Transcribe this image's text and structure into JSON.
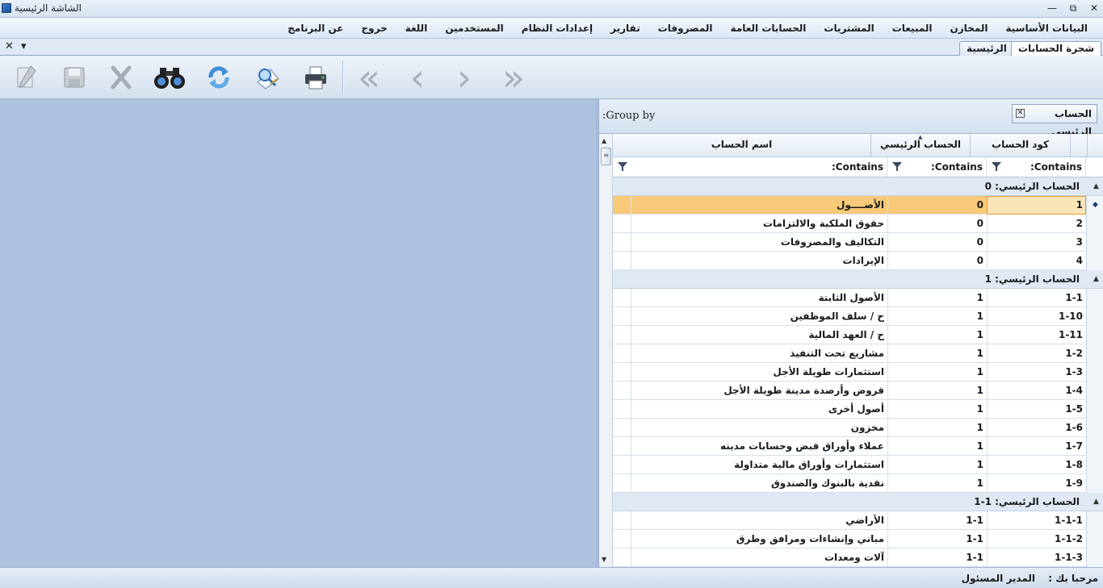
{
  "window": {
    "title": "الشاشة الرئيسية",
    "minimize": "—",
    "restore": "⧉",
    "close": "✕"
  },
  "menu": [
    "البيانات الأساسية",
    "المخازن",
    "المبيعات",
    "المشتريات",
    "الحسابات العامة",
    "المصروفات",
    "تقارير",
    "إعدادات النظام",
    "المستخدمين",
    "اللغة",
    "خروج",
    "عن البرنامج"
  ],
  "tabs": {
    "accounts_tree": "شجرة الحسابات",
    "home": "الرئيسية",
    "close": "✕",
    "dropdown": "▾"
  },
  "toolbar": {
    "items": [
      "last-record",
      "next-record",
      "previous-record",
      "first-record",
      "print",
      "preview",
      "refresh",
      "search",
      "delete",
      "save",
      "edit"
    ]
  },
  "grid": {
    "group_by_label": ":Group  by",
    "group_chip": "الحساب الرئيسي",
    "chip_close": "✕",
    "columns": {
      "code": "كود الحساب",
      "parent": "الحساب الرئيسي",
      "name": "اسم الحساب"
    },
    "filter": {
      "code": "Contains:",
      "parent": "Contains:",
      "name": "Contains:"
    },
    "groups": [
      {
        "label": "الحساب الرئيسي: 0",
        "rows": [
          {
            "code": "1",
            "parent": "0",
            "name": "الأصــــول",
            "selected": true
          },
          {
            "code": "2",
            "parent": "0",
            "name": "حقوق الملكية والالتزامات"
          },
          {
            "code": "3",
            "parent": "0",
            "name": "التكاليف والمصروفات"
          },
          {
            "code": "4",
            "parent": "0",
            "name": "الإيرادات"
          }
        ]
      },
      {
        "label": "الحساب الرئيسي: 1",
        "rows": [
          {
            "code": "1-1",
            "parent": "1",
            "name": "الأصول الثابتة"
          },
          {
            "code": "1-10",
            "parent": "1",
            "name": "ح / سلف الموظفين"
          },
          {
            "code": "1-11",
            "parent": "1",
            "name": "ح / العهد المالية"
          },
          {
            "code": "1-2",
            "parent": "1",
            "name": "مشاريع تحت التنفيذ"
          },
          {
            "code": "1-3",
            "parent": "1",
            "name": "استثمارات طويلة الأجل"
          },
          {
            "code": "1-4",
            "parent": "1",
            "name": "قروض وأرصدة مدينة طويلة الأجل"
          },
          {
            "code": "1-5",
            "parent": "1",
            "name": "أصول أخرى"
          },
          {
            "code": "1-6",
            "parent": "1",
            "name": "مخزون"
          },
          {
            "code": "1-7",
            "parent": "1",
            "name": "عملاء وأوراق قبض وحسابات مدينه"
          },
          {
            "code": "1-8",
            "parent": "1",
            "name": "استثمارات وأوراق مالية متداولة"
          },
          {
            "code": "1-9",
            "parent": "1",
            "name": "نقدية بالبنوك والصندوق"
          }
        ]
      },
      {
        "label": "الحساب الرئيسي: 1-1",
        "rows": [
          {
            "code": "1-1-1",
            "parent": "1-1",
            "name": "الأراضي"
          },
          {
            "code": "1-1-2",
            "parent": "1-1",
            "name": "مباني وإنشاءات ومرافق وطرق"
          },
          {
            "code": "1-1-3",
            "parent": "1-1",
            "name": "آلات ومعدات"
          }
        ]
      }
    ]
  },
  "status": {
    "welcome": "مرحبا بك :",
    "user": "المدير المسئول"
  }
}
